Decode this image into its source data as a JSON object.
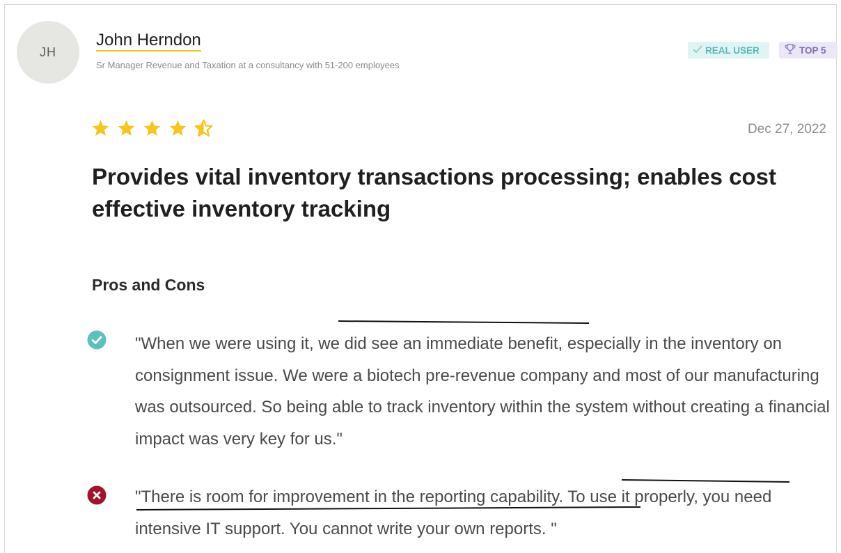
{
  "reviewer": {
    "initials": "JH",
    "name": "John Herndon",
    "role": "Sr Manager Revenue and Taxation at a consultancy with 51-200 employees"
  },
  "badges": {
    "real_user": "REAL USER",
    "top": "TOP 5"
  },
  "review": {
    "rating": 4.5,
    "rating_max": 5,
    "date": "Dec 27, 2022",
    "title": "Provides vital inventory transactions processing; enables cost effective inventory tracking"
  },
  "pros_cons": {
    "heading": "Pros and Cons",
    "pro": "\"When we were using it, we did see an immediate benefit, especially in the inventory on consignment issue. We were a biotech pre-revenue company and most of our manufacturing was outsourced. So being able to track inventory within the system without creating a financial impact was very key for us.\"",
    "con": "\"There is room for improvement in the reporting capability. To use it properly, you need intensive IT support. You cannot write your own reports. \""
  },
  "colors": {
    "star": "#f6c61c",
    "pro_icon": "#5cc0bd",
    "con_icon": "#a3142b",
    "name_underline": "#f3c81a"
  },
  "icons": {
    "avatar": "initials-avatar",
    "real_user": "check-icon",
    "top": "trophy-icon",
    "pro": "check-circle-icon",
    "con": "x-circle-icon"
  }
}
